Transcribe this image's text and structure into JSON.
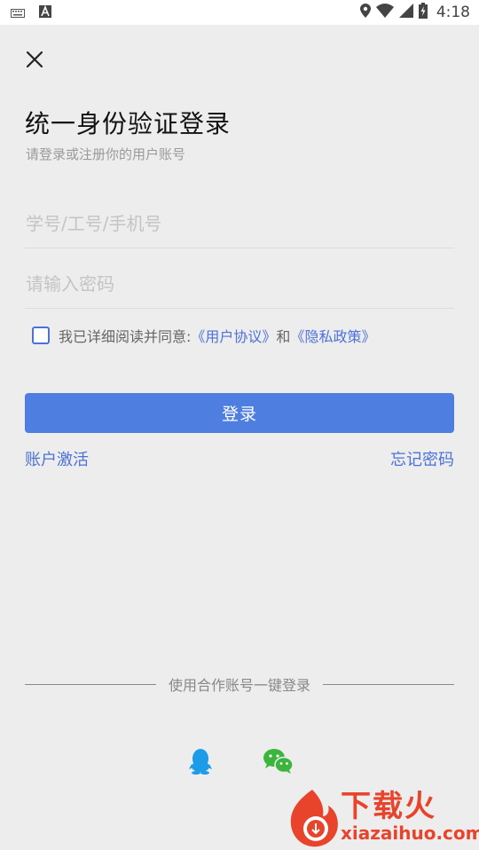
{
  "status_bar": {
    "time": "4:18",
    "icons": [
      "keyboard-icon",
      "font-a-icon",
      "location-icon",
      "wifi-icon",
      "signal-icon",
      "battery-icon"
    ]
  },
  "header": {
    "title": "统一身份验证登录",
    "subtitle": "请登录或注册你的用户账号"
  },
  "form": {
    "account_placeholder": "学号/工号/手机号",
    "account_value": "",
    "password_placeholder": "请输入密码",
    "password_value": ""
  },
  "agreement": {
    "checked": false,
    "prefix": "我已详细阅读并同意:",
    "user_agreement": "《用户协议》",
    "conjunction": "和",
    "privacy_policy": "《隐私政策》"
  },
  "actions": {
    "login_label": "登录",
    "activate_label": "账户激活",
    "forgot_label": "忘记密码"
  },
  "partner_login": {
    "label": "使用合作账号一键登录",
    "providers": [
      "qq-icon",
      "wechat-icon"
    ]
  },
  "watermark": {
    "cn": "下载火",
    "en": "xiazaihuo.com"
  },
  "colors": {
    "accent": "#4e7ee0",
    "link": "#4c72d9",
    "background": "#ededed",
    "qq": "#1e9be8",
    "wechat": "#3bb53b",
    "watermark": "#e8442c"
  }
}
